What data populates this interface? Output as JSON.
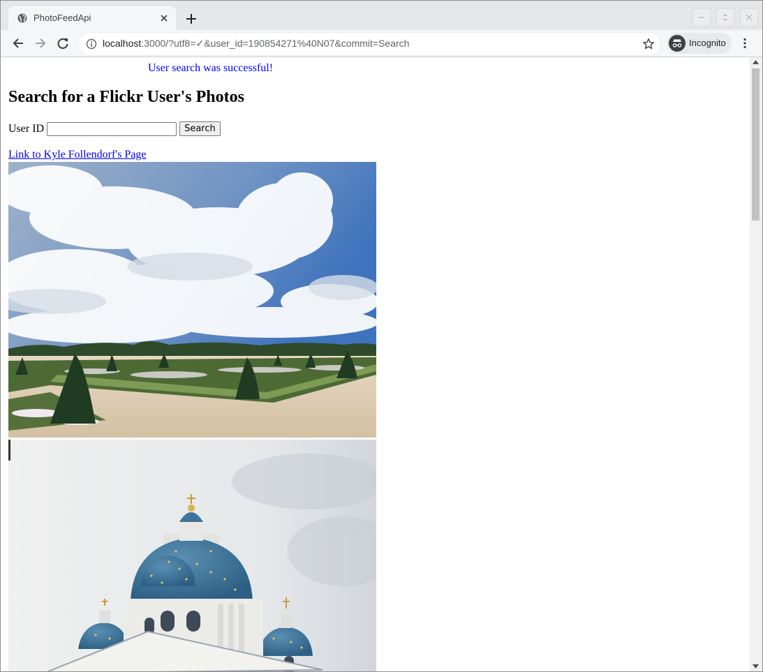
{
  "browser": {
    "tab_title": "PhotoFeedApi",
    "url_host": "localhost",
    "url_rest": ":3000/?utf8=✓&user_id=190854271%40N07&commit=Search",
    "incognito_label": "Incognito"
  },
  "page": {
    "notice": "User search was successful!",
    "heading": "Search for a Flickr User's Photos",
    "form": {
      "label": "User ID",
      "input_value": "",
      "button_label": "Search"
    },
    "user_link": "Link to Kyle Follendorf's Page"
  },
  "icons": {
    "favicon": "globe-icon",
    "close": "close-icon",
    "new_tab": "plus-icon",
    "back": "back-arrow-icon",
    "forward": "forward-arrow-icon",
    "reload": "reload-icon",
    "info": "info-icon",
    "star": "star-icon",
    "incognito": "incognito-icon",
    "menu": "kebab-menu-icon"
  }
}
